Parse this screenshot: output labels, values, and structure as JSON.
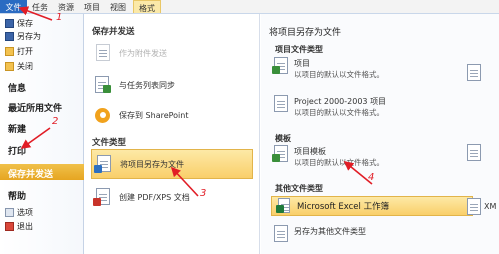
{
  "ribbon": {
    "tabs": [
      "文件",
      "任务",
      "资源",
      "项目",
      "视图",
      "格式"
    ]
  },
  "nav": {
    "small_top": [
      "保存",
      "另存为",
      "打开",
      "关闭"
    ],
    "info": "信息",
    "recent": "最近所用文件",
    "new": "新建",
    "print": "打印",
    "save_send": "保存并发送",
    "help": "帮助",
    "small_bottom": [
      "选项",
      "退出"
    ]
  },
  "middle": {
    "header_save_send": "保存并发送",
    "attach": "作为附件发送",
    "sync": "与任务列表同步",
    "sharepoint": "保存到 SharePoint",
    "header_file_types": "文件类型",
    "save_project_as": "将项目另存为文件",
    "create_pdf": "创建 PDF/XPS 文档"
  },
  "right": {
    "title": "将项目另存为文件",
    "project_file_types": "项目文件类型",
    "project": "项目",
    "project_desc": "以项目的默认以文件格式。",
    "project2000": "Project 2000-2003 项目",
    "project2000_desc": "以项目的默认以文件格式。",
    "template_header": "模板",
    "project_template": "项目模板",
    "project_template_desc": "以项目的默认以文件格式。",
    "other_types": "其他文件类型",
    "excel_workbook": "Microsoft Excel 工作簿",
    "xml_partial": "XM",
    "save_other": "另存为其他文件类型"
  },
  "annotations": [
    "1",
    "2",
    "3",
    "4"
  ],
  "colors": {
    "file_tab": "#2a6bc2",
    "accent_orange": "#e6a521",
    "highlight_yellow": "#f9cf6a",
    "annotation_red": "#e11d26"
  }
}
